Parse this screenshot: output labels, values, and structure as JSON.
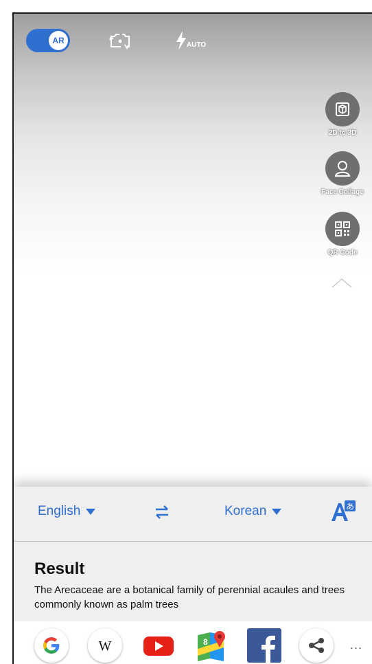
{
  "camera": {
    "ar_toggle_label": "AR",
    "flash_mode": "AUTO"
  },
  "tools": [
    {
      "label": "2D to 3D",
      "icon": "cube-icon"
    },
    {
      "label": "Face Collage",
      "icon": "person-icon"
    },
    {
      "label": "QR Code",
      "icon": "qr-code-icon"
    }
  ],
  "translate": {
    "source_language": "English",
    "target_language": "Korean"
  },
  "result": {
    "title": "Result",
    "text": "The Arecaceae are a botanical family of perennial acaules and trees commonly known as palm trees"
  },
  "share_apps": [
    {
      "name": "google",
      "icon": "google-icon"
    },
    {
      "name": "wikipedia",
      "icon": "wikipedia-icon"
    },
    {
      "name": "youtube",
      "icon": "youtube-icon"
    },
    {
      "name": "maps",
      "icon": "maps-icon"
    },
    {
      "name": "facebook",
      "icon": "facebook-icon"
    },
    {
      "name": "share",
      "icon": "share-icon"
    }
  ],
  "more_label": "...",
  "colors": {
    "accent": "#2f6fd0",
    "tool_circle": "#6f6f6f",
    "panel": "#efefef"
  }
}
